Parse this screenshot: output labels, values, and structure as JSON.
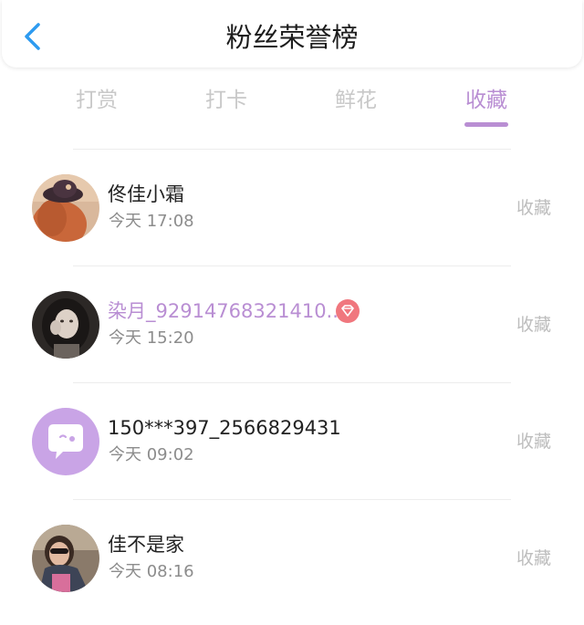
{
  "header": {
    "title": "粉丝荣誉榜"
  },
  "tabs": [
    {
      "label": "打赏",
      "active": false
    },
    {
      "label": "打卡",
      "active": false
    },
    {
      "label": "鲜花",
      "active": false
    },
    {
      "label": "收藏",
      "active": true
    }
  ],
  "colors": {
    "accent": "#b98ed3",
    "back_arrow": "#2d9bf0",
    "badge": "#f0777e"
  },
  "fans": [
    {
      "name": "佟佳小霜",
      "time": "今天 17:08",
      "action": "收藏",
      "avatar_icon": "photo-avatar-hat",
      "vip": false
    },
    {
      "name": "染月_92914768321410...",
      "time": "今天 15:20",
      "action": "收藏",
      "avatar_icon": "photo-avatar-girl",
      "vip": true,
      "badge_icon": "diamond-icon"
    },
    {
      "name": "150***397_2566829431",
      "time": "今天 09:02",
      "action": "收藏",
      "avatar_icon": "default-chat-bubble-avatar",
      "vip": false
    },
    {
      "name": "佳不是家",
      "time": "今天 08:16",
      "action": "收藏",
      "avatar_icon": "photo-avatar-sunglasses",
      "vip": false
    }
  ]
}
